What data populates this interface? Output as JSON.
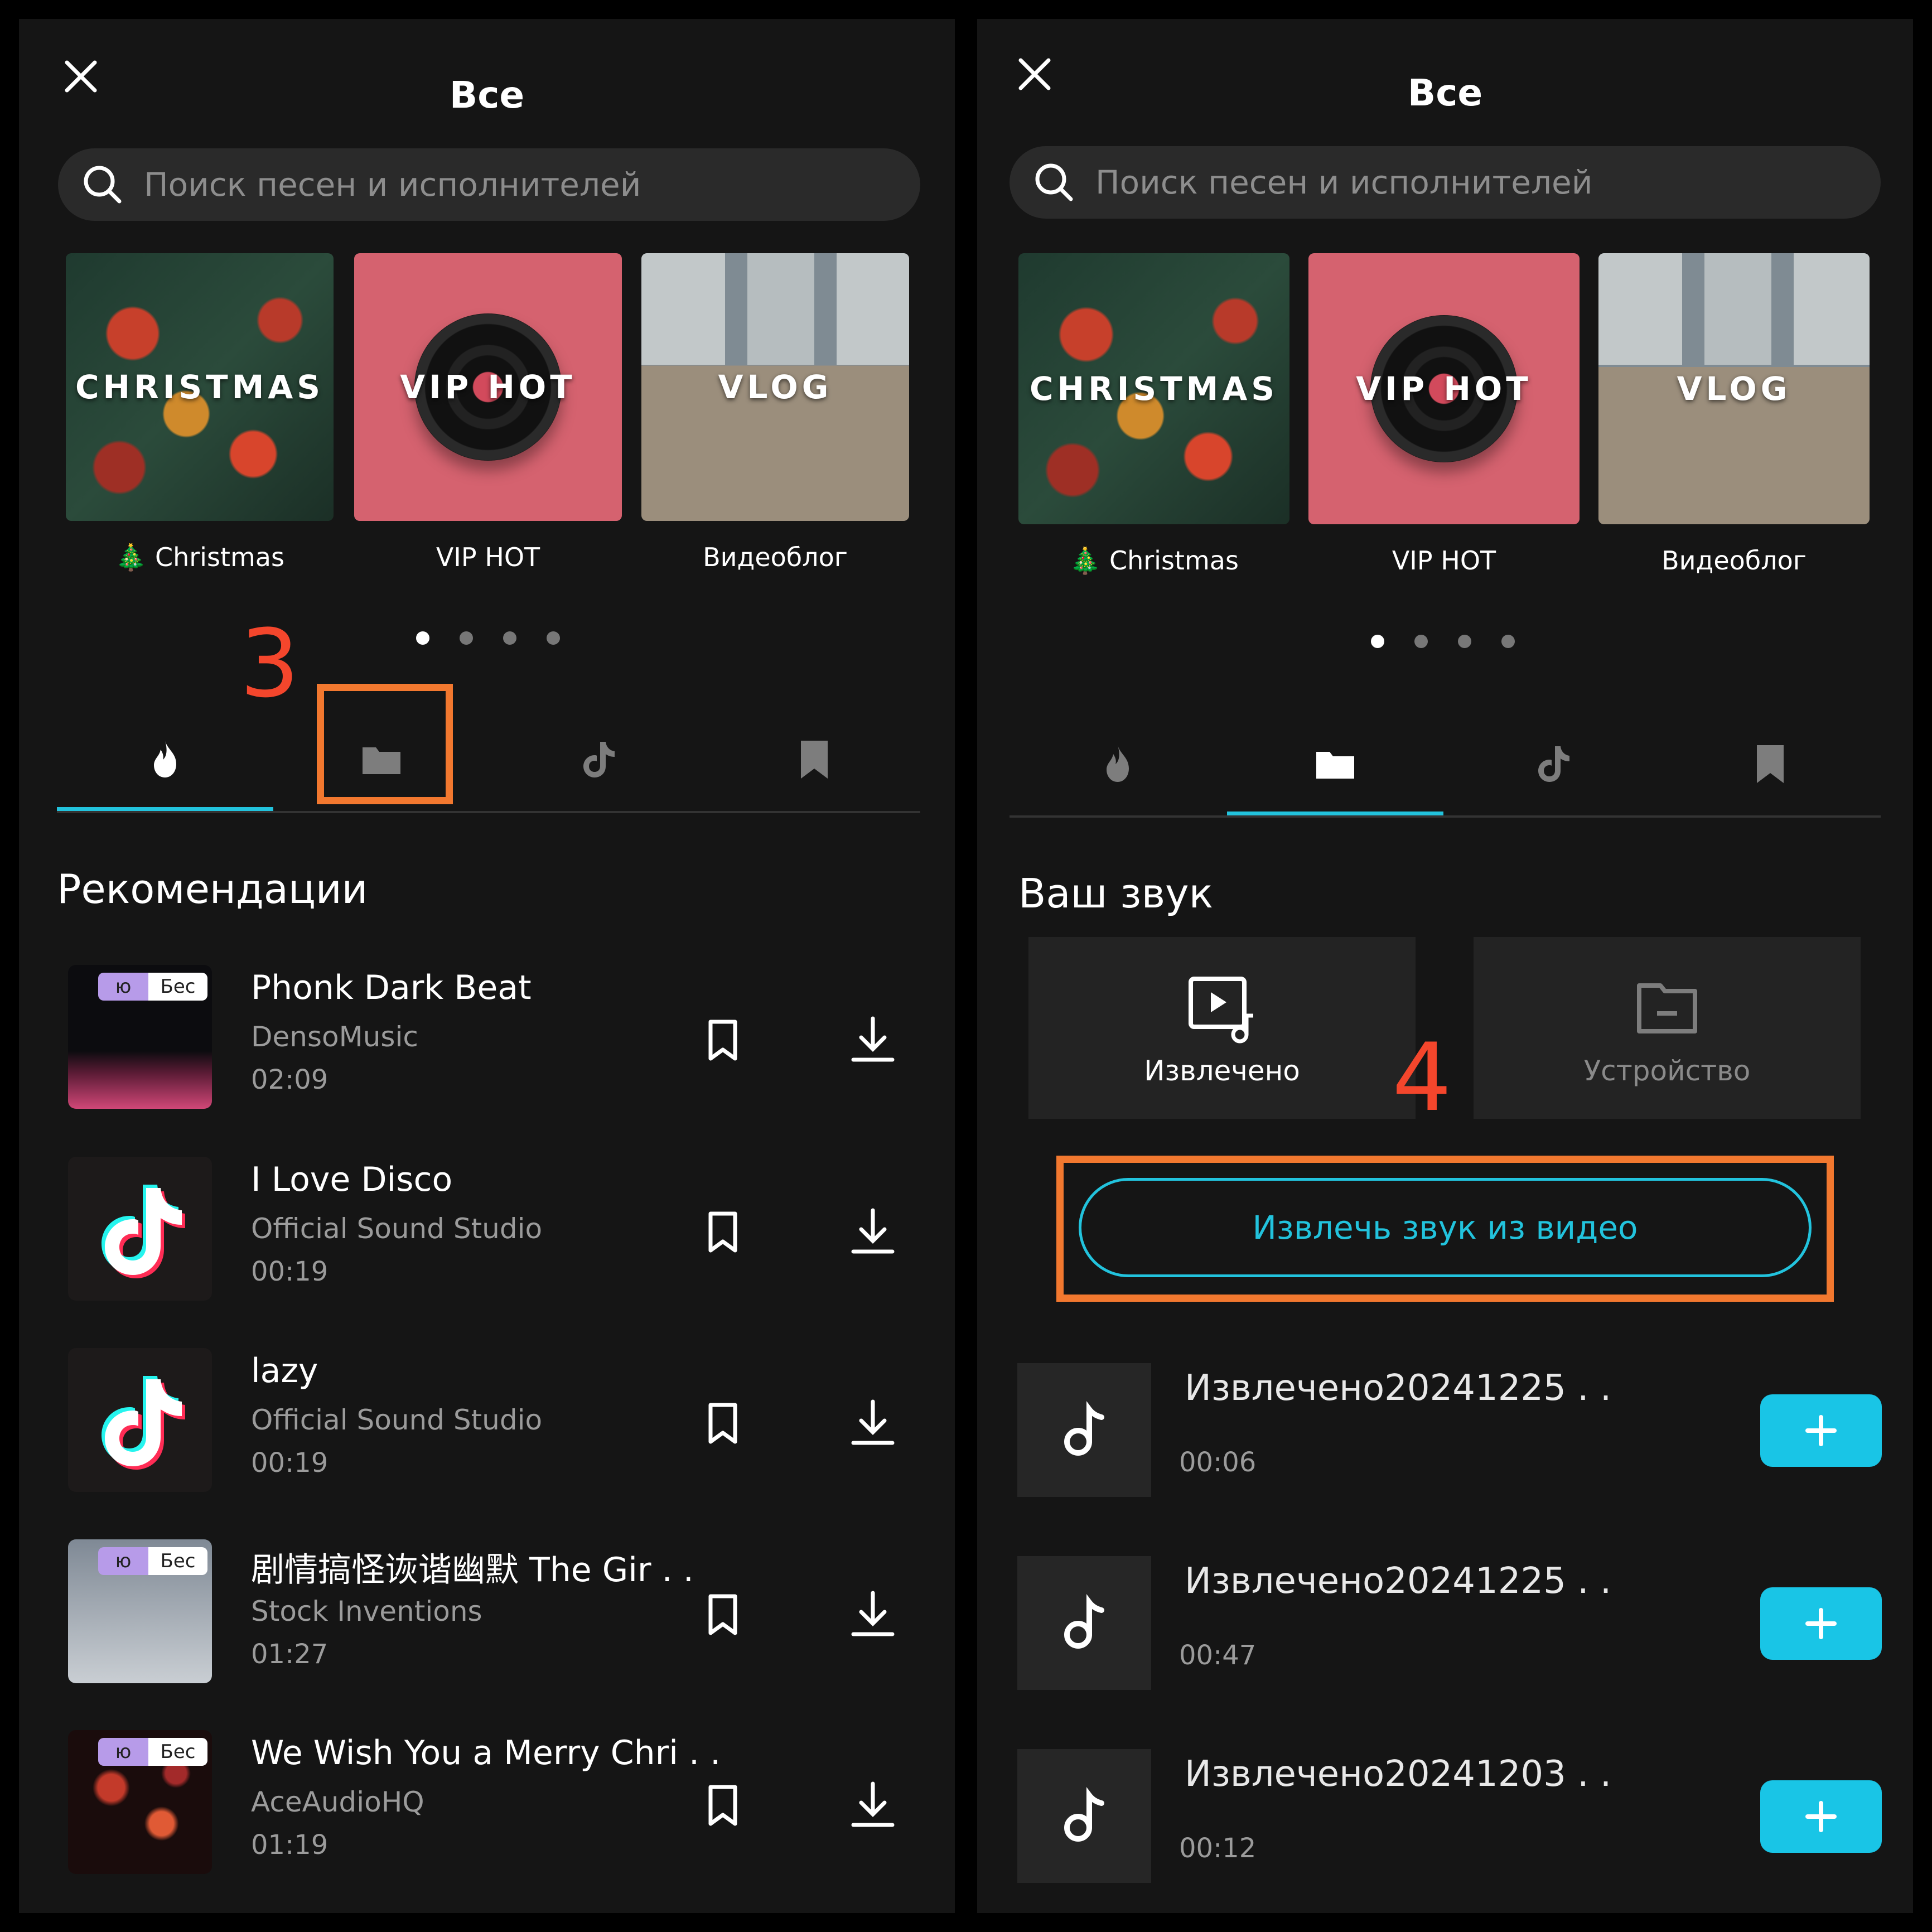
{
  "colors": {
    "accent": "#22c3dd",
    "highlight": "#f2782f",
    "step_number": "#f4462c",
    "add_button": "#19c5e6"
  },
  "left": {
    "title": "Все",
    "search": {
      "placeholder": "Поиск песен и исполнителей",
      "icon": "search-icon"
    },
    "playlists": [
      {
        "overlay": "CHRISTMAS",
        "label": "🎄 Christmas"
      },
      {
        "overlay": "VIP HOT",
        "label": "VIP HOT"
      },
      {
        "overlay": "VLOG",
        "label": "Видеоблог"
      }
    ],
    "carousel_page": 1,
    "carousel_pages": 4,
    "step_number": "3",
    "tabs": [
      {
        "icon": "flame-icon",
        "active": true
      },
      {
        "icon": "folder-icon",
        "active": false
      },
      {
        "icon": "tiktok-icon",
        "active": false
      },
      {
        "icon": "bookmark-icon",
        "active": false
      }
    ],
    "section_title": "Рекомендации",
    "tracks": [
      {
        "title": "Phonk Dark Beat",
        "artist": "DensoMusic",
        "duration": "02:09",
        "badge": [
          "ю",
          "Бес"
        ]
      },
      {
        "title": "I Love Disco",
        "artist": "Official Sound Studio",
        "duration": "00:19"
      },
      {
        "title": "lazy",
        "artist": "Official Sound Studio",
        "duration": "00:19"
      },
      {
        "title": "剧情搞怪诙谐幽默  The Gir . .",
        "artist": "Stock Inventions",
        "duration": "01:27",
        "badge": [
          "ю",
          "Бес"
        ]
      },
      {
        "title": "We Wish You a Merry Chri . .",
        "artist": "AceAudioHQ",
        "duration": "01:19",
        "badge": [
          "ю",
          "Бес"
        ]
      }
    ]
  },
  "right": {
    "title": "Все",
    "search": {
      "placeholder": "Поиск песен и исполнителей",
      "icon": "search-icon"
    },
    "playlists": [
      {
        "overlay": "CHRISTMAS",
        "label": "🎄 Christmas"
      },
      {
        "overlay": "VIP HOT",
        "label": "VIP HOT"
      },
      {
        "overlay": "VLOG",
        "label": "Видеоблог"
      }
    ],
    "carousel_page": 1,
    "carousel_pages": 4,
    "tabs": [
      {
        "icon": "flame-icon",
        "active": false
      },
      {
        "icon": "folder-icon",
        "active": true
      },
      {
        "icon": "tiktok-icon",
        "active": false
      },
      {
        "icon": "bookmark-icon",
        "active": false
      }
    ],
    "section_title": "Ваш звук",
    "sources": [
      {
        "label": "Извлечено",
        "icon": "video-music-icon"
      },
      {
        "label": "Устройство",
        "icon": "device-folder-icon"
      }
    ],
    "step_number": "4",
    "extract_button": "Извлечь звук из видео",
    "extracted": [
      {
        "name": "Извлечено20241225 . .",
        "duration": "00:06"
      },
      {
        "name": "Извлечено20241225 . .",
        "duration": "00:47"
      },
      {
        "name": "Извлечено20241203 . .",
        "duration": "00:12"
      }
    ],
    "add_label": "+"
  }
}
